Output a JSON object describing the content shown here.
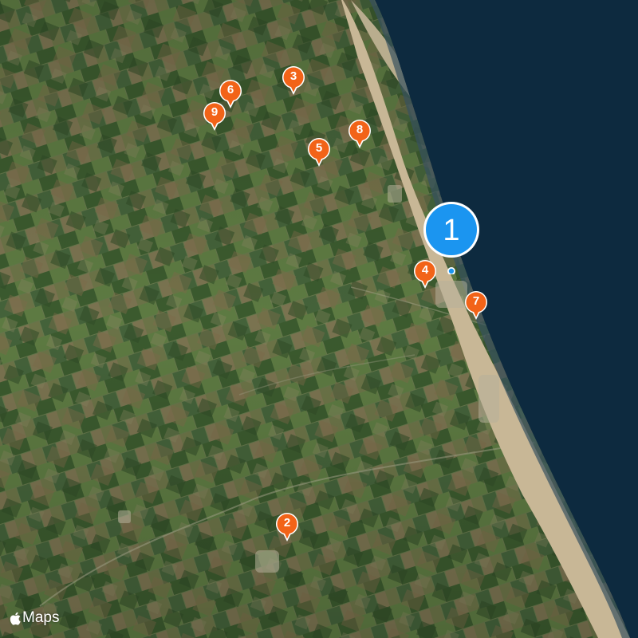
{
  "map": {
    "basemap": "satellite",
    "accent_colors": {
      "current_pin": "#1b95f0",
      "pin": "#f26318",
      "sea": "#0d2a3f",
      "beach": "#c8b796"
    },
    "pins": [
      {
        "label": "1",
        "kind": "selected"
      },
      {
        "label": "2",
        "kind": "standard"
      },
      {
        "label": "3",
        "kind": "standard"
      },
      {
        "label": "4",
        "kind": "standard"
      },
      {
        "label": "5",
        "kind": "standard"
      },
      {
        "label": "6",
        "kind": "standard"
      },
      {
        "label": "7",
        "kind": "standard"
      },
      {
        "label": "8",
        "kind": "standard"
      },
      {
        "label": "9",
        "kind": "standard"
      }
    ]
  },
  "attribution": {
    "icon": "apple-logo-icon",
    "text": "Maps"
  }
}
